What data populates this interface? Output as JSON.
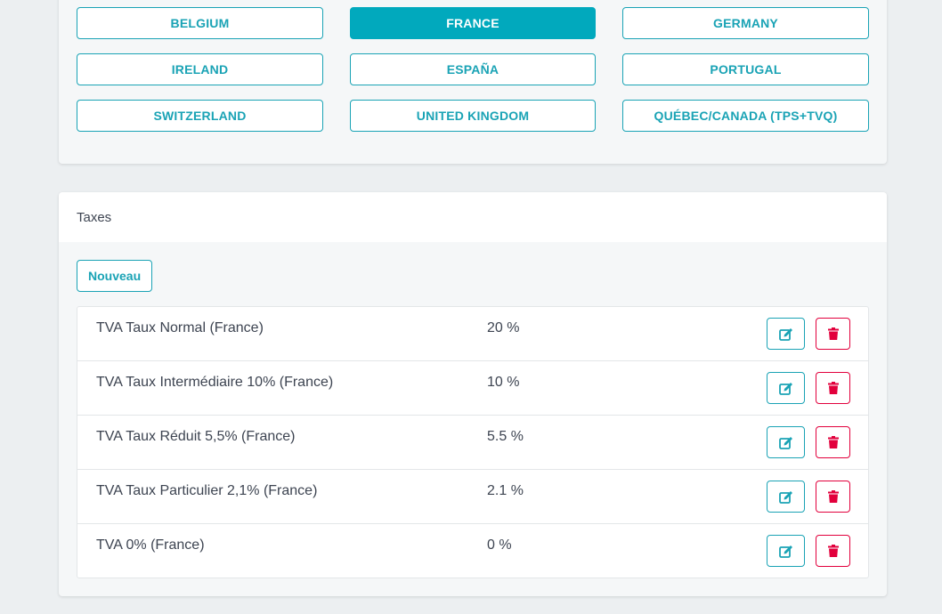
{
  "countries": [
    {
      "label": "BELGIUM",
      "active": false
    },
    {
      "label": "FRANCE",
      "active": true
    },
    {
      "label": "GERMANY",
      "active": false
    },
    {
      "label": "IRELAND",
      "active": false
    },
    {
      "label": "ESPAÑA",
      "active": false
    },
    {
      "label": "PORTUGAL",
      "active": false
    },
    {
      "label": "SWITZERLAND",
      "active": false
    },
    {
      "label": "UNITED KINGDOM",
      "active": false
    },
    {
      "label": "QUÉBEC/CANADA (TPS+TVQ)",
      "active": false
    }
  ],
  "taxes": {
    "title": "Taxes",
    "new_label": "Nouveau",
    "rows": [
      {
        "name": "TVA Taux Normal (France)",
        "rate": "20 %"
      },
      {
        "name": "TVA Taux Intermédiaire 10% (France)",
        "rate": "10 %"
      },
      {
        "name": "TVA Taux Réduit 5,5% (France)",
        "rate": "5.5 %"
      },
      {
        "name": "TVA Taux Particulier 2,1% (France)",
        "rate": "2.1 %"
      },
      {
        "name": "TVA 0% (France)",
        "rate": "0 %"
      }
    ],
    "edit_icon": "edit-icon",
    "delete_icon": "trash-icon"
  },
  "colors": {
    "accent": "#01a9bd",
    "danger": "#e2003c"
  }
}
